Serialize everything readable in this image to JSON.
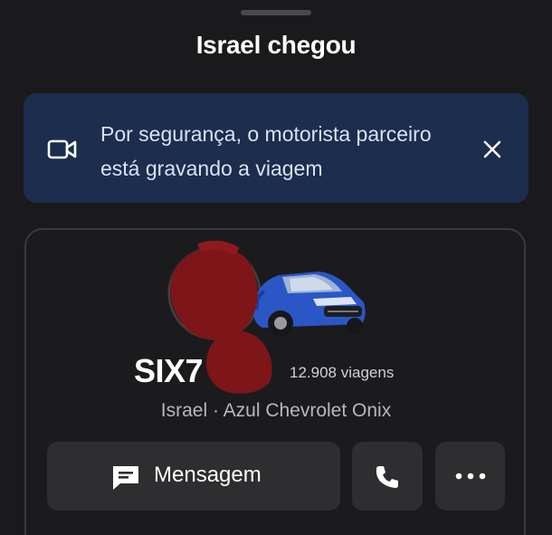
{
  "sheet": {
    "title": "Israel chegou"
  },
  "banner": {
    "icon": "video-camera-icon",
    "text": "Por segurança, o motorista parceiro está gravando a viagem",
    "close_icon": "close-icon",
    "bg_color": "#1c2d4e"
  },
  "driver": {
    "plate": "SIX7",
    "trips": "12.908 viagens",
    "details": "Israel · Azul Chevrolet Onix",
    "car_color": "#2b57c6"
  },
  "actions": {
    "message_label": "Mensagem",
    "message_icon": "chat-icon",
    "call_icon": "phone-icon",
    "more_icon": "more-dots-icon"
  }
}
